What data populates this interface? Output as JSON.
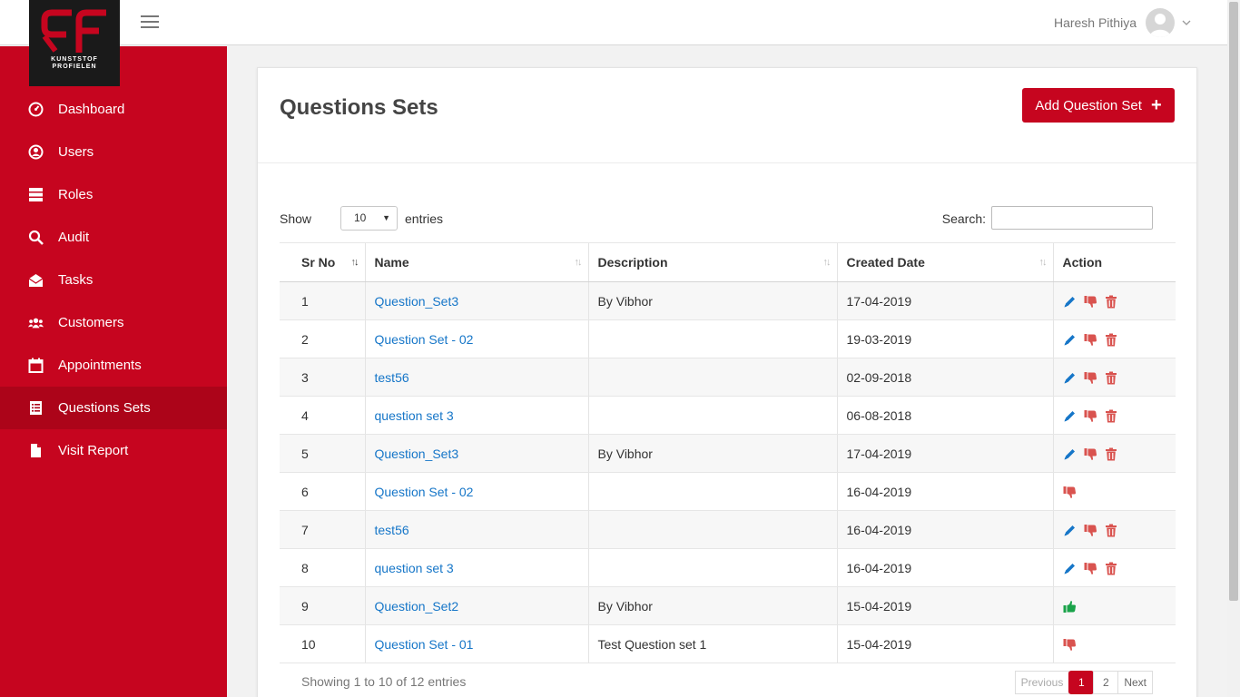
{
  "header": {
    "user_name": "Haresh Pithiya"
  },
  "logo": {
    "line1": "KUNSTSTOF",
    "line2": "PROFIELEN"
  },
  "colors": {
    "brand": "#c6051f",
    "link": "#1676c8",
    "edit": "#1676c8",
    "dislike": "#d9534f",
    "delete": "#d9534f",
    "like": "#1aa34a"
  },
  "sidebar": {
    "items": [
      {
        "label": "Dashboard",
        "icon": "dashboard-icon"
      },
      {
        "label": "Users",
        "icon": "user-circle-icon"
      },
      {
        "label": "Roles",
        "icon": "server-icon"
      },
      {
        "label": "Audit",
        "icon": "search-icon"
      },
      {
        "label": "Tasks",
        "icon": "envelope-open-icon"
      },
      {
        "label": "Customers",
        "icon": "users-icon"
      },
      {
        "label": "Appointments",
        "icon": "calendar-icon"
      },
      {
        "label": "Questions Sets",
        "icon": "list-icon",
        "active": true
      },
      {
        "label": "Visit Report",
        "icon": "file-icon"
      }
    ]
  },
  "main": {
    "title": "Questions Sets",
    "add_button": "Add Question Set",
    "show_label": "Show",
    "page_length": "10",
    "entries_label": "entries",
    "search_label": "Search:",
    "search_value": "",
    "columns": [
      "Sr No",
      "Name",
      "Description",
      "Created Date",
      "Action"
    ],
    "rows": [
      {
        "sr": "1",
        "name": "Question_Set3",
        "description": "By Vibhor",
        "date": "17-04-2019",
        "actions": [
          "edit",
          "dislike",
          "delete"
        ]
      },
      {
        "sr": "2",
        "name": "Question Set - 02",
        "description": "",
        "date": "19-03-2019",
        "actions": [
          "edit",
          "dislike",
          "delete"
        ]
      },
      {
        "sr": "3",
        "name": "test56",
        "description": "",
        "date": "02-09-2018",
        "actions": [
          "edit",
          "dislike",
          "delete"
        ]
      },
      {
        "sr": "4",
        "name": "question set 3",
        "description": "",
        "date": "06-08-2018",
        "actions": [
          "edit",
          "dislike",
          "delete"
        ]
      },
      {
        "sr": "5",
        "name": "Question_Set3",
        "description": "By Vibhor",
        "date": "17-04-2019",
        "actions": [
          "edit",
          "dislike",
          "delete"
        ]
      },
      {
        "sr": "6",
        "name": "Question Set - 02",
        "description": "",
        "date": "16-04-2019",
        "actions": [
          "dislike"
        ]
      },
      {
        "sr": "7",
        "name": "test56",
        "description": "",
        "date": "16-04-2019",
        "actions": [
          "edit",
          "dislike",
          "delete"
        ]
      },
      {
        "sr": "8",
        "name": "question set 3",
        "description": "",
        "date": "16-04-2019",
        "actions": [
          "edit",
          "dislike",
          "delete"
        ]
      },
      {
        "sr": "9",
        "name": "Question_Set2",
        "description": "By Vibhor",
        "date": "15-04-2019",
        "actions": [
          "like"
        ]
      },
      {
        "sr": "10",
        "name": "Question Set - 01",
        "description": "Test Question set 1",
        "date": "15-04-2019",
        "actions": [
          "dislike"
        ]
      }
    ],
    "info": "Showing 1 to 10 of 12 entries",
    "pagination": {
      "previous": "Previous",
      "pages": [
        "1",
        "2"
      ],
      "current": "1",
      "next": "Next"
    }
  }
}
